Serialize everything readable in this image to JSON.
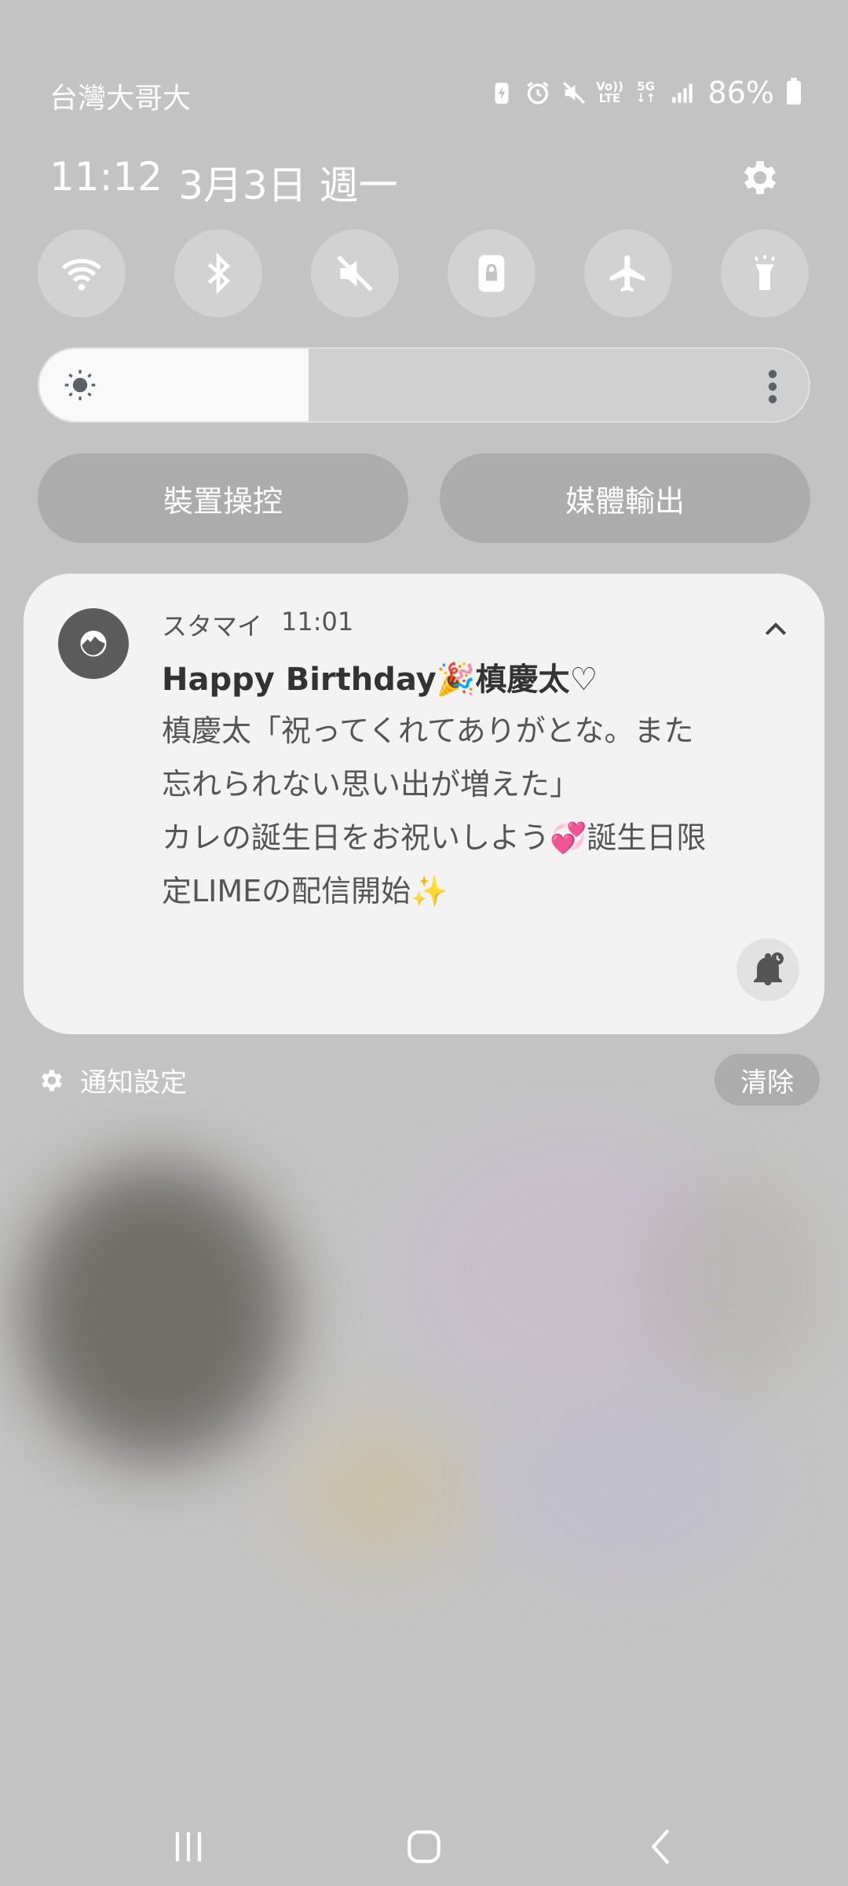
{
  "status_bar": {
    "carrier": "台灣大哥大",
    "volte_top": "Vo))",
    "volte_bottom": "LTE",
    "network": "5G",
    "battery_percent": "86%"
  },
  "header": {
    "time": "11:12",
    "date": "3月3日 週一"
  },
  "quick_toggles": [
    "wifi-icon",
    "bluetooth-icon",
    "mute-icon",
    "rotation-lock-icon",
    "airplane-icon",
    "flashlight-icon"
  ],
  "brightness": {
    "level": 0.35
  },
  "controls": {
    "device_control": "裝置操控",
    "media_output": "媒體輸出"
  },
  "notification": {
    "app_name": "スタマイ",
    "time": "11:01",
    "title": "Happy Birthday🎉槙慶太♡",
    "body_lines": [
      "槙慶太「祝ってくれてありがとな。また",
      "忘れられない思い出が増えた」",
      "カレの誕生日をお祝いしよう💞誕生日限",
      "定LIMEの配信開始✨"
    ]
  },
  "footer": {
    "notification_settings": "通知設定",
    "clear": "清除"
  },
  "colors": {
    "panel_bg": "#c3c3c3",
    "card_bg": "#f3f3f3",
    "icon_fill": "#ffffff"
  }
}
